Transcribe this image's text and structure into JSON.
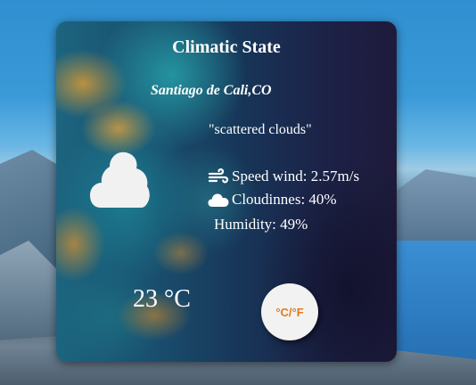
{
  "weather": {
    "title": "Climatic State",
    "city": "Santiago de Cali,CO",
    "description": "\"scattered clouds\"",
    "wind": "Speed wind: 2.57m/s",
    "cloudiness": "Cloudinnes: 40%",
    "humidity": "Humidity: 49%",
    "temperature": "23 °C",
    "condition_icon": "cloud-icon",
    "wind_icon": "wind-icon",
    "cloud_small_icon": "cloud-icon"
  },
  "controls": {
    "unit_toggle_label": "°C/°F"
  },
  "colors": {
    "unit_toggle_text": "#e07a1e",
    "unit_toggle_bg": "#f2f2f2",
    "text": "#ffffff"
  }
}
